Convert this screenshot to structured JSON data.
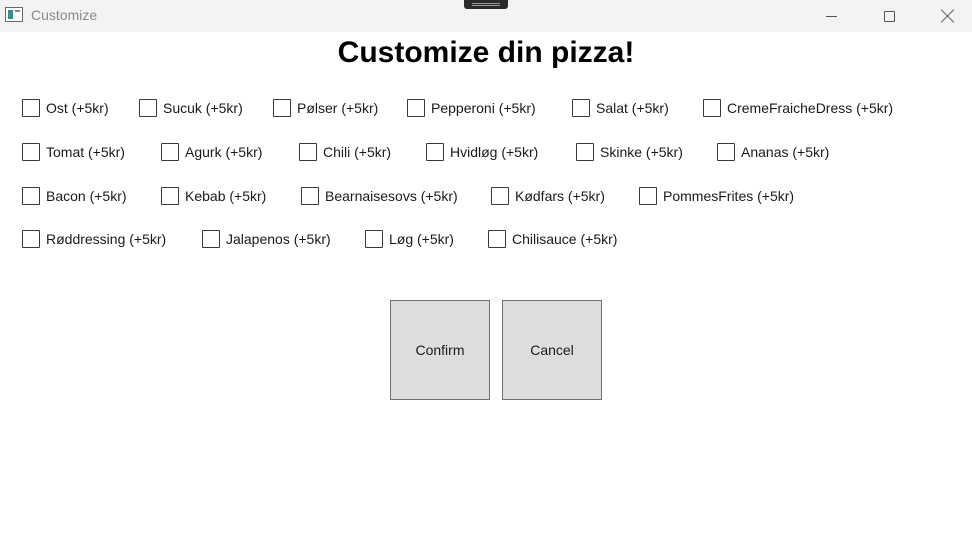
{
  "window": {
    "title": "Customize",
    "icon": "app-window-icon",
    "controls": [
      "minimize-icon",
      "maximize-icon",
      "close-icon"
    ]
  },
  "heading": "Customize din pizza!",
  "toppings": [
    [
      {
        "label": "Ost (+5kr)",
        "checked": false
      },
      {
        "label": "Sucuk (+5kr)",
        "checked": false
      },
      {
        "label": "Pølser (+5kr)",
        "checked": false
      },
      {
        "label": "Pepperoni (+5kr)",
        "checked": false
      },
      {
        "label": "Salat (+5kr)",
        "checked": false
      },
      {
        "label": "CremeFraicheDress (+5kr)",
        "checked": false
      }
    ],
    [
      {
        "label": "Tomat (+5kr)",
        "checked": false
      },
      {
        "label": "Agurk (+5kr)",
        "checked": false
      },
      {
        "label": "Chili (+5kr)",
        "checked": false
      },
      {
        "label": "Hvidløg (+5kr)",
        "checked": false
      },
      {
        "label": "Skinke (+5kr)",
        "checked": false
      },
      {
        "label": "Ananas (+5kr)",
        "checked": false
      }
    ],
    [
      {
        "label": "Bacon (+5kr)",
        "checked": false
      },
      {
        "label": "Kebab (+5kr)",
        "checked": false
      },
      {
        "label": "Bearnaisesovs (+5kr)",
        "checked": false
      },
      {
        "label": "Kødfars (+5kr)",
        "checked": false
      },
      {
        "label": "PommesFrites (+5kr)",
        "checked": false
      }
    ],
    [
      {
        "label": "Røddressing (+5kr)",
        "checked": false
      },
      {
        "label": "Jalapenos (+5kr)",
        "checked": false
      },
      {
        "label": "Løg (+5kr)",
        "checked": false
      },
      {
        "label": "Chilisauce (+5kr)",
        "checked": false
      }
    ]
  ],
  "buttons": {
    "confirm": "Confirm",
    "cancel": "Cancel"
  }
}
